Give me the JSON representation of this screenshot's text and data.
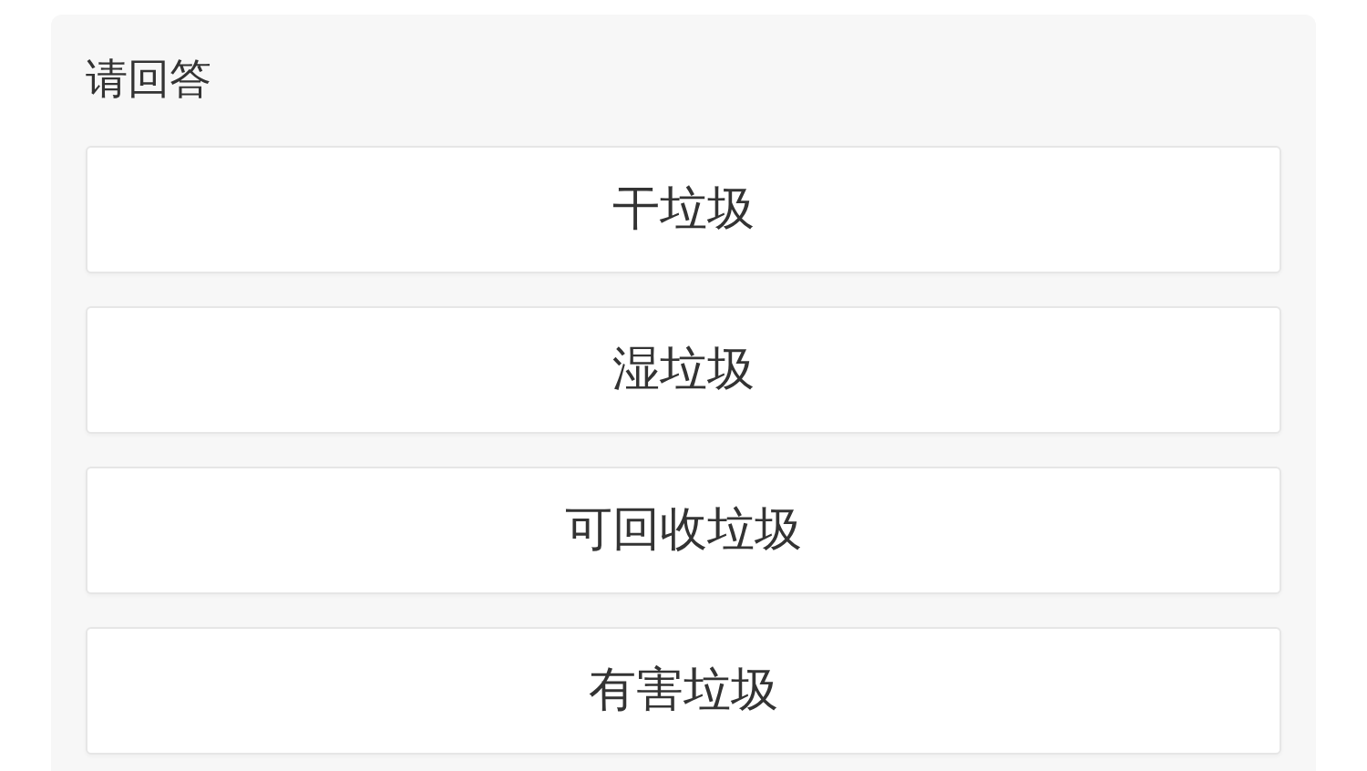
{
  "prompt": "请回答",
  "options": [
    {
      "label": "干垃圾"
    },
    {
      "label": "湿垃圾"
    },
    {
      "label": "可回收垃圾"
    },
    {
      "label": "有害垃圾"
    }
  ]
}
